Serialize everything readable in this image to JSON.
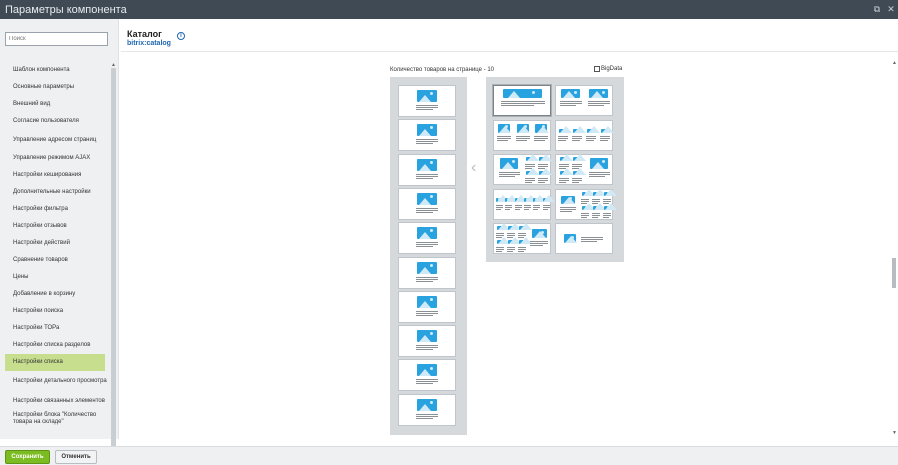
{
  "window": {
    "title": "Параметры компонента"
  },
  "sidebar": {
    "search_placeholder": "Поиск",
    "items": [
      {
        "label": "Шаблон компонента"
      },
      {
        "label": "Основные параметры"
      },
      {
        "label": "Внешний вид"
      },
      {
        "label": "Согласие пользователя"
      },
      {
        "label": "Управление адресом страниц"
      },
      {
        "label": "Управление режимом AJAX"
      },
      {
        "label": "Настройки кеширования"
      },
      {
        "label": "Дополнительные настройки"
      },
      {
        "label": "Настройки фильтра"
      },
      {
        "label": "Настройки отзывов"
      },
      {
        "label": "Настройки действий"
      },
      {
        "label": "Сравнение товаров"
      },
      {
        "label": "Цены"
      },
      {
        "label": "Добавление в корзину"
      },
      {
        "label": "Настройки поиска"
      },
      {
        "label": "Настройки ТОРа"
      },
      {
        "label": "Настройки списка разделов"
      },
      {
        "label": "Настройки списка",
        "active": true
      },
      {
        "label": "Настройки детального просмотра"
      },
      {
        "label": "Настройки связанных элементов"
      },
      {
        "label": "Настройки блока \"Количество товара на складе\""
      }
    ]
  },
  "component": {
    "name": "Каталог",
    "code": "bitrix:catalog",
    "info_icon": "info-icon"
  },
  "layout_editor": {
    "count_label": "Количество товаров на странице - 10",
    "bigdata_label": "BigData",
    "bigdata_checked": false,
    "prev_icon": "chevron-left-icon"
  },
  "footer": {
    "save_label": "Сохранить",
    "cancel_label": "Отменить"
  },
  "colors": {
    "titlebar": "#3f4a54",
    "accent_green": "#7cbc23",
    "active_item": "#c7de8e",
    "link_blue": "#2067b0",
    "image_placeholder": "#29a3e0"
  }
}
